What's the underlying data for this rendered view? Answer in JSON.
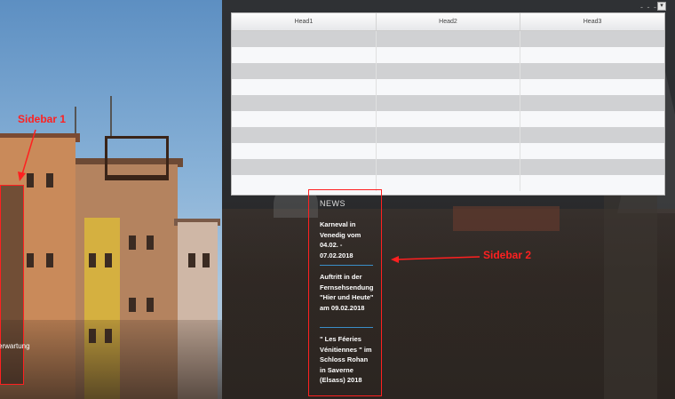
{
  "left_sidebar": {
    "label": "Sidebar 1",
    "partial_text": "erwartung"
  },
  "toolbar": {
    "dots": "- - -",
    "dropdown_icon": "chevron-down-icon"
  },
  "table": {
    "headers": [
      "Head1",
      "Head2",
      "Head3"
    ],
    "rows": [
      [
        "",
        "",
        ""
      ],
      [
        "",
        "",
        ""
      ],
      [
        "",
        "",
        ""
      ],
      [
        "",
        "",
        ""
      ],
      [
        "",
        "",
        ""
      ],
      [
        "",
        "",
        ""
      ],
      [
        "",
        "",
        ""
      ],
      [
        "",
        "",
        ""
      ],
      [
        "",
        "",
        ""
      ],
      [
        "",
        "",
        ""
      ]
    ]
  },
  "news": {
    "title": "NEWS",
    "items": [
      "Karneval in Venedig vom 04.02. - 07.02.2018",
      "Auftritt in der Fernsehsendung \"Hier und Heute\" am 09.02.2018",
      "\" Les Féeries Vénitiennes \" im Schloss Rohan in Saverne (Elsass) 2018"
    ]
  },
  "annotations": {
    "sidebar2_label": "Sidebar 2"
  },
  "colors": {
    "annotation_red": "#ff2020",
    "separator_blue": "#3a8ec8"
  }
}
